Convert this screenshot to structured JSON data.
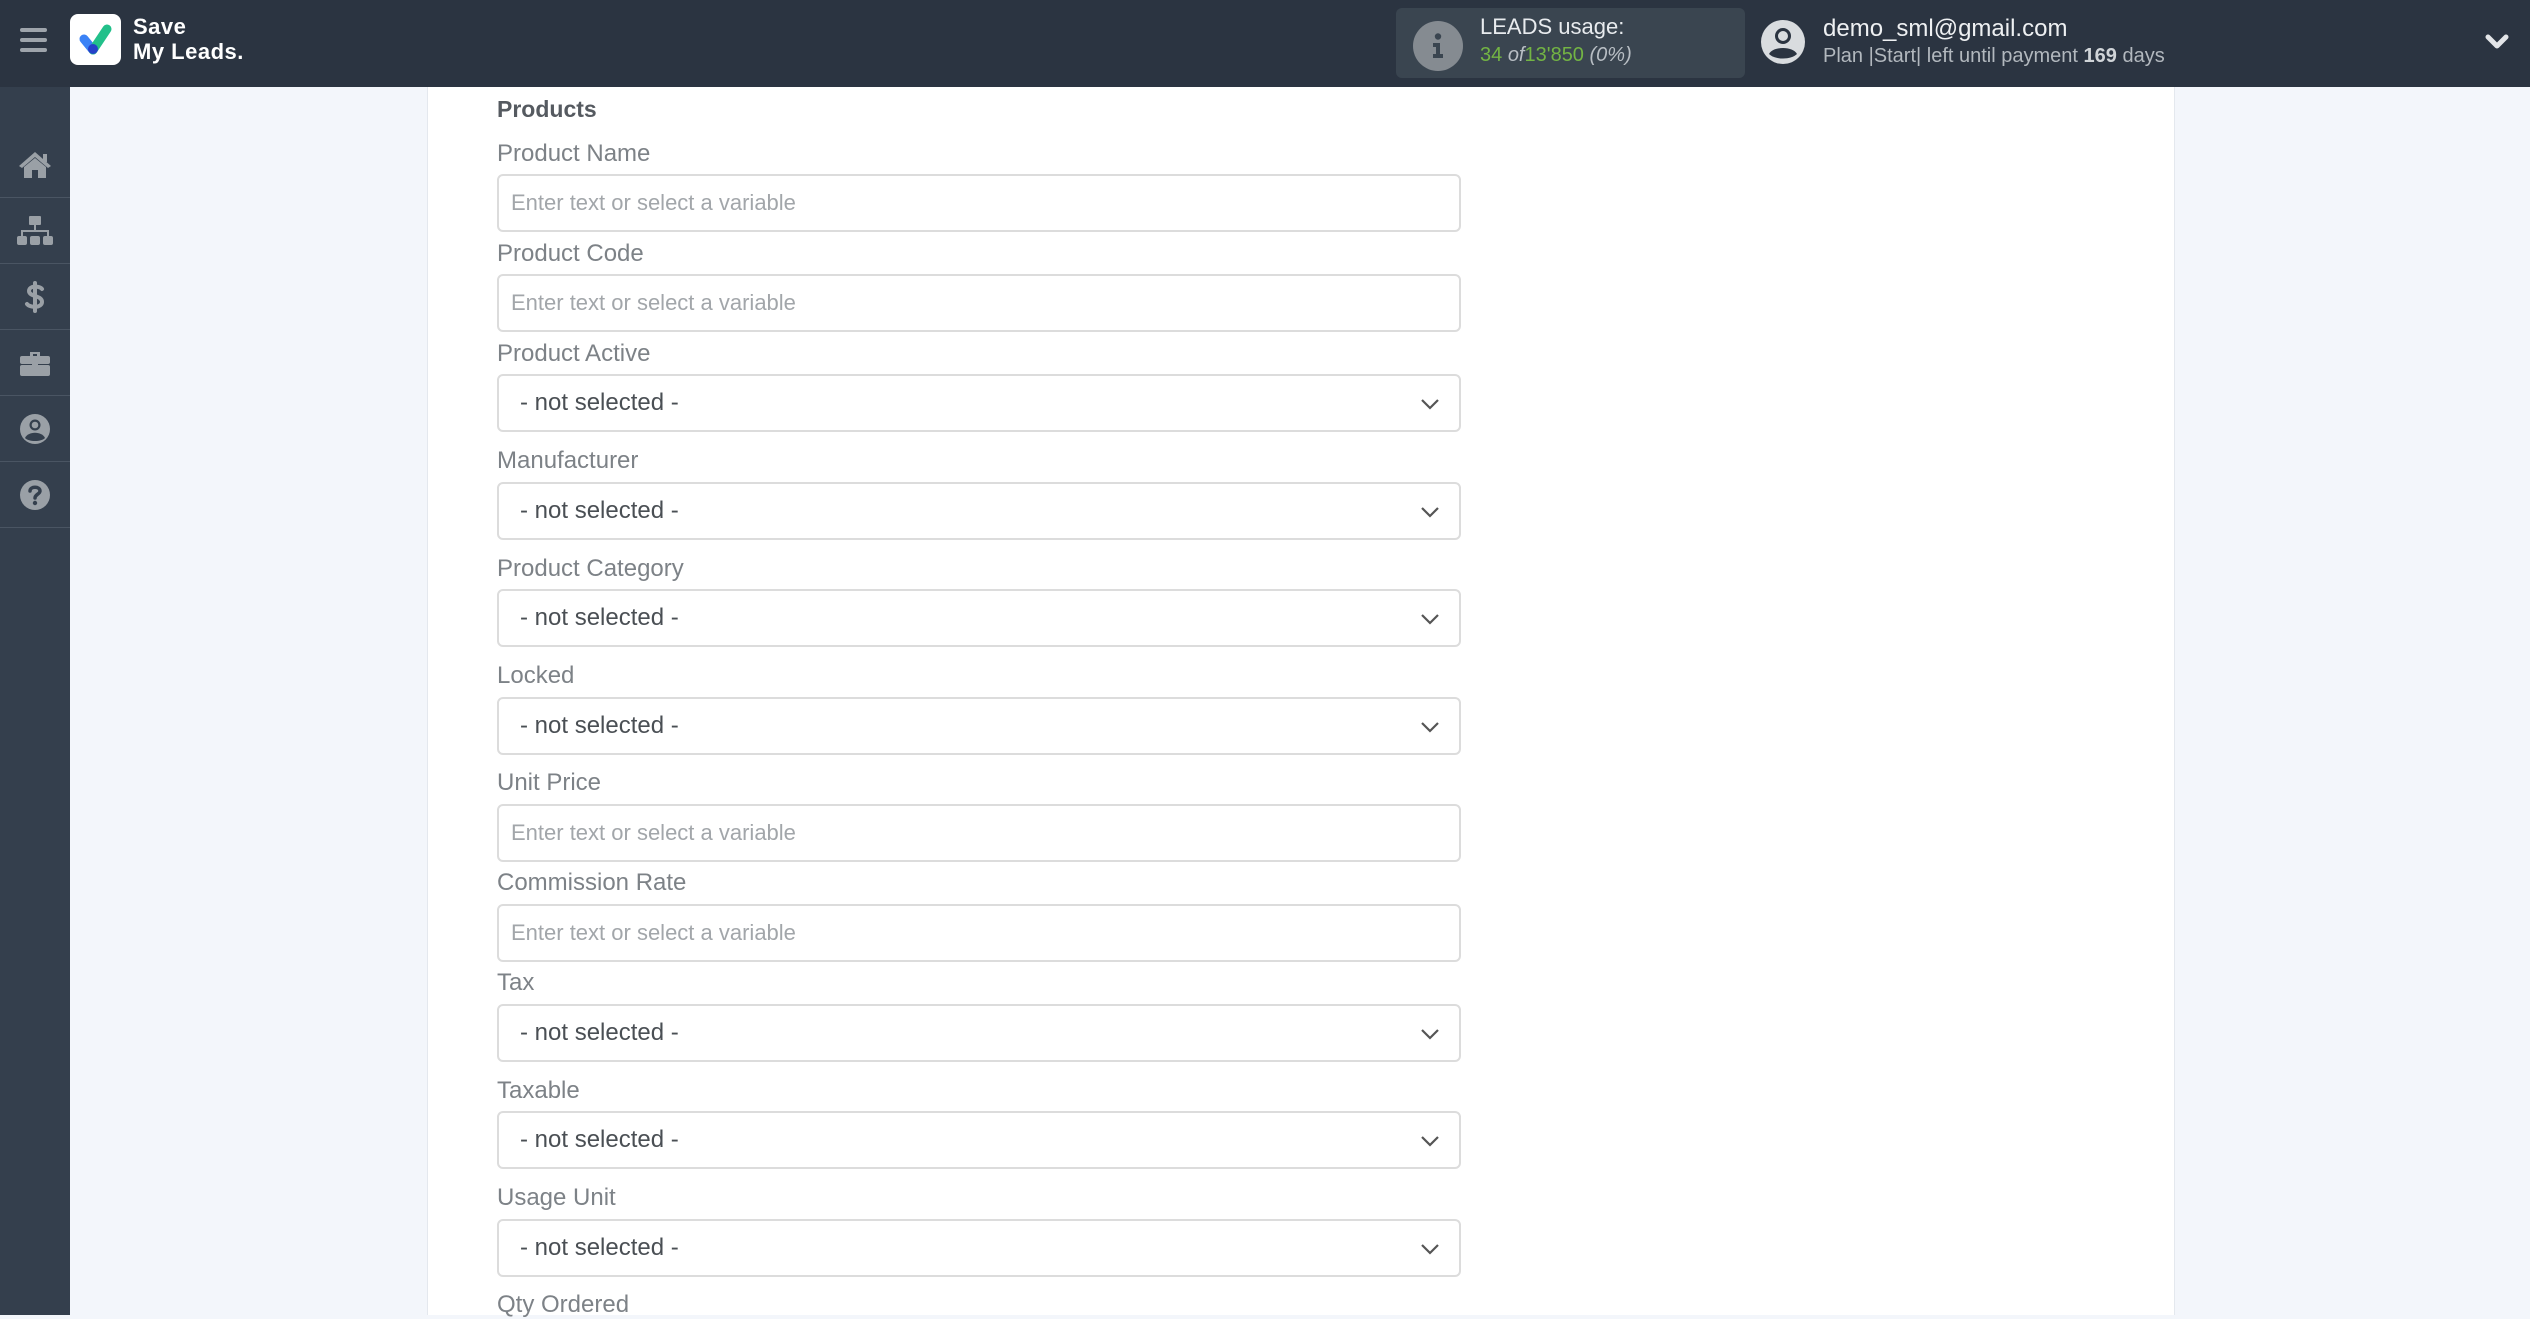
{
  "header": {
    "logo_line1": "Save",
    "logo_line2": "My Leads.",
    "leads": {
      "title": "LEADS usage:",
      "used": "34",
      "of_label": "of",
      "total": "13'850",
      "percent": "(0%)"
    },
    "user": {
      "email": "demo_sml@gmail.com",
      "plan_prefix": "Plan |Start| left until payment",
      "days_count": "169",
      "days_suffix": "days"
    }
  },
  "sidebar": {
    "items": [
      {
        "name": "home",
        "icon": "home-icon"
      },
      {
        "name": "connections",
        "icon": "sitemap-icon"
      },
      {
        "name": "billing",
        "icon": "dollar-icon"
      },
      {
        "name": "tools",
        "icon": "briefcase-icon"
      },
      {
        "name": "account",
        "icon": "user-circle-icon"
      },
      {
        "name": "help",
        "icon": "question-circle-icon"
      }
    ]
  },
  "form": {
    "section_title": "Products",
    "fields": [
      {
        "label": "Product Name",
        "type": "input",
        "placeholder": "Enter text or select a variable",
        "value": ""
      },
      {
        "label": "Product Code",
        "type": "input",
        "placeholder": "Enter text or select a variable",
        "value": ""
      },
      {
        "label": "Product Active",
        "type": "select",
        "value": "- not selected -"
      },
      {
        "label": "Manufacturer",
        "type": "select",
        "value": "- not selected -"
      },
      {
        "label": "Product Category",
        "type": "select",
        "value": "- not selected -"
      },
      {
        "label": "Locked",
        "type": "select",
        "value": "- not selected -"
      },
      {
        "label": "Unit Price",
        "type": "input",
        "placeholder": "Enter text or select a variable",
        "value": ""
      },
      {
        "label": "Commission Rate",
        "type": "input",
        "placeholder": "Enter text or select a variable",
        "value": ""
      },
      {
        "label": "Tax",
        "type": "select",
        "value": "- not selected -"
      },
      {
        "label": "Taxable",
        "type": "select",
        "value": "- not selected -"
      },
      {
        "label": "Usage Unit",
        "type": "select",
        "value": "- not selected -"
      },
      {
        "label": "Qty Ordered",
        "type": "partial"
      }
    ]
  }
}
